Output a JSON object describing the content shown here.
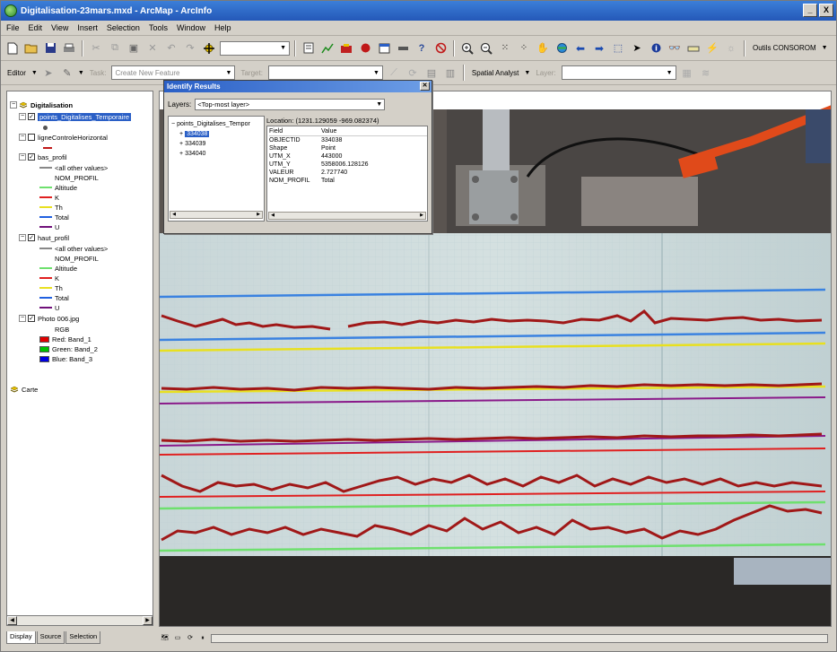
{
  "window": {
    "title": "Digitalisation-23mars.mxd - ArcMap - ArcInfo",
    "min": "_",
    "close": "X"
  },
  "menu": [
    "File",
    "Edit",
    "View",
    "Insert",
    "Selection",
    "Tools",
    "Window",
    "Help"
  ],
  "toolbar": {
    "scale_value": "",
    "outils_label": "Outils CONSOROM",
    "editor_label": "Editor",
    "task_label": "Task:",
    "task_value": "Create New Feature",
    "target_label": "Target:",
    "spatial_analyst_label": "Spatial Analyst",
    "layer_label": "Layer:"
  },
  "toc": {
    "root": "Digitalisation",
    "layers": [
      {
        "name": "points_Digitalises_Temporaire",
        "checked": true,
        "selected": true
      },
      {
        "name": "ligneControleHorizontal",
        "checked": false
      },
      {
        "name": "bas_profil",
        "checked": true
      },
      {
        "name": "haut_profil",
        "checked": true
      },
      {
        "name": "Photo 006.jpg",
        "checked": true
      }
    ],
    "bas_legend": [
      "<all other values>",
      "NOM_PROFIL",
      "Altitude",
      "K",
      "Th",
      "Total",
      "U"
    ],
    "haut_legend": [
      "<all other values>",
      "NOM_PROFIL",
      "Altitude",
      "K",
      "Th",
      "Total",
      "U"
    ],
    "photo_legend": [
      "RGB",
      "Red:   Band_1",
      "Green: Band_2",
      "Blue:  Band_3"
    ],
    "carte": "Carte",
    "tabs": [
      "Display",
      "Source",
      "Selection"
    ]
  },
  "colors": {
    "altitude": "#6ee06e",
    "k": "#e02020",
    "th": "#e8e020",
    "total": "#2060e0",
    "u": "#70107a",
    "red_band": "#e00000",
    "green_band": "#00c000",
    "blue_band": "#0000e0",
    "profile_line": "#a01818"
  },
  "identify": {
    "title": "Identify Results",
    "layers_label": "Layers:",
    "layers_value": "<Top-most layer>",
    "tree_root": "points_Digitalises_Tempor",
    "features": [
      "334038",
      "334039",
      "334040"
    ],
    "location": "Location: (1231.129059 -969.082374)",
    "fields_header": [
      "Field",
      "Value"
    ],
    "fields": [
      [
        "OBJECTID",
        "334038"
      ],
      [
        "Shape",
        "Point"
      ],
      [
        "UTM_X",
        "443000"
      ],
      [
        "UTM_Y",
        "5358006.128126"
      ],
      [
        "VALEUR",
        "2.727740"
      ],
      [
        "NOM_PROFIL",
        "Total"
      ]
    ]
  }
}
